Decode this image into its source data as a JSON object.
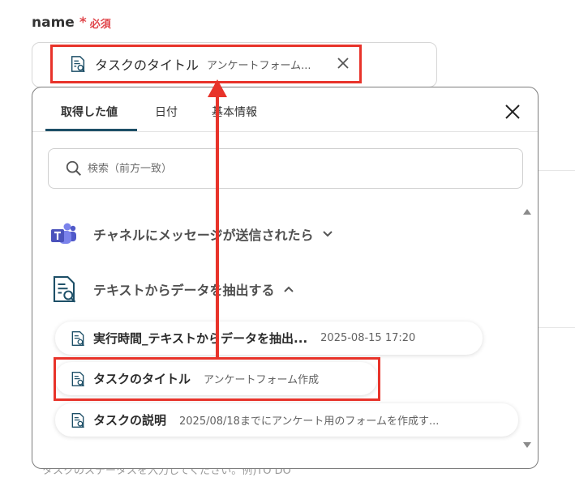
{
  "field": {
    "label": "name",
    "required_mark": "*",
    "required_text": "必須",
    "chip": {
      "label": "タスクのタイトル",
      "value": "アンケートフォーム..."
    }
  },
  "picker": {
    "tabs": [
      "取得した値",
      "日付",
      "基本情報"
    ],
    "active_tab": "取得した値",
    "search_placeholder": "検索（前方一致）",
    "groups": [
      {
        "label": "チャネルにメッセージが送信されたら",
        "expanded": false,
        "icon": "teams-icon"
      },
      {
        "label": "テキストからデータを抽出する",
        "expanded": true,
        "icon": "document-search-icon"
      }
    ],
    "items": [
      {
        "label": "実行時間_テキストからデータを抽出...",
        "value": "2025-08-15 17:20"
      },
      {
        "label": "タスクのタイトル",
        "value": "アンケートフォーム作成"
      },
      {
        "label": "タスクの説明",
        "value": "2025/08/18までにアンケート用のフォームを作成す..."
      }
    ]
  },
  "background": {
    "hint_text": "タスクのステータスを入力してください。例)TO DO"
  },
  "colors": {
    "highlight": "#e8332a",
    "accent": "#1d4f67",
    "required": "#e0474c"
  }
}
